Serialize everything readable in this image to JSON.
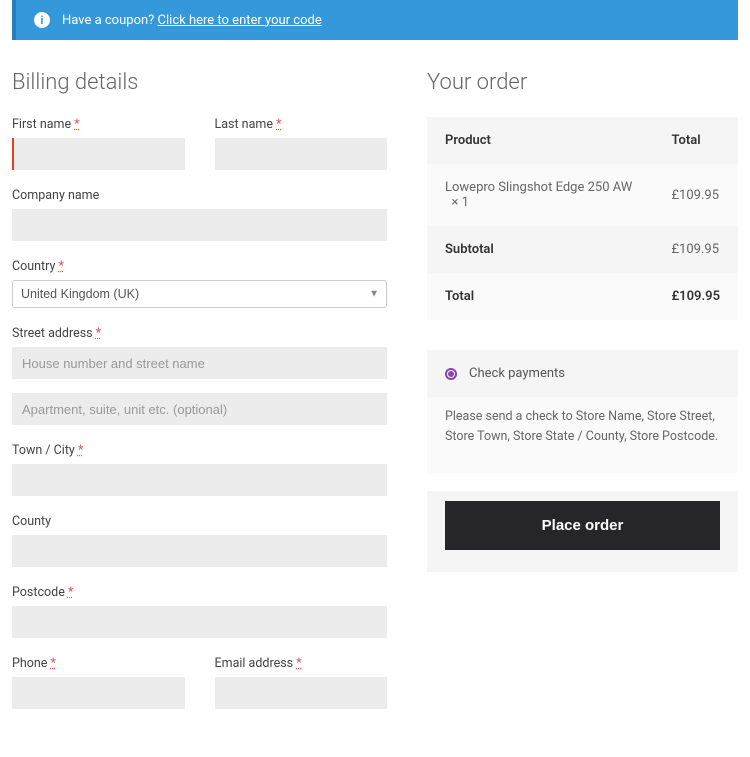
{
  "coupon": {
    "prompt": "Have a coupon?",
    "link": "Click here to enter your code"
  },
  "billing": {
    "heading": "Billing details",
    "first_name": {
      "label": "First name"
    },
    "last_name": {
      "label": "Last name"
    },
    "company": {
      "label": "Company name"
    },
    "country": {
      "label": "Country",
      "value": "United Kingdom (UK)"
    },
    "street": {
      "label": "Street address",
      "placeholder1": "House number and street name",
      "placeholder2": "Apartment, suite, unit etc. (optional)"
    },
    "town": {
      "label": "Town / City"
    },
    "county": {
      "label": "County"
    },
    "postcode": {
      "label": "Postcode"
    },
    "phone": {
      "label": "Phone"
    },
    "email": {
      "label": "Email address"
    },
    "required_mark": "*"
  },
  "order": {
    "heading": "Your order",
    "cols": {
      "product": "Product",
      "total": "Total"
    },
    "items": [
      {
        "name": "Lowepro Slingshot Edge 250 AW",
        "qty": "× 1",
        "total": "£109.95"
      }
    ],
    "subtotal": {
      "label": "Subtotal",
      "value": "£109.95"
    },
    "total": {
      "label": "Total",
      "value": "£109.95"
    }
  },
  "payment": {
    "method_label": "Check payments",
    "description": "Please send a check to Store Name, Store Street, Store Town, Store State / County, Store Postcode."
  },
  "actions": {
    "place_order": "Place order"
  }
}
